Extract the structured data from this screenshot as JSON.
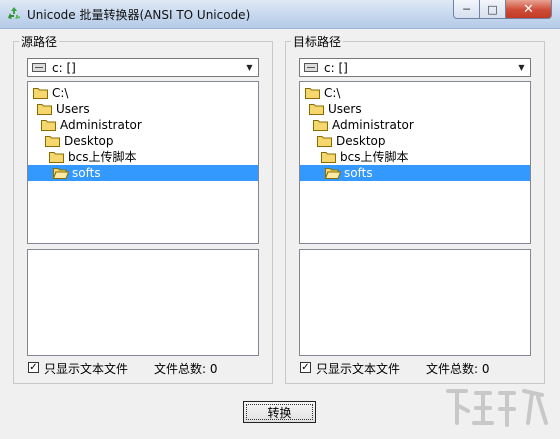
{
  "window": {
    "title": "Unicode 批量转换器(ANSI TO Unicode)",
    "controls": {
      "minimize": "─",
      "maximize": "□",
      "close": "✕"
    }
  },
  "panels": [
    {
      "title": "源路径",
      "drive": "c: []",
      "tree": [
        "C:\\",
        "Users",
        "Administrator",
        "Desktop",
        "bcs上传脚本",
        "softs"
      ],
      "selected": "softs",
      "files": [],
      "checkbox": {
        "checked": true,
        "label": "只显示文本文件"
      },
      "count": "文件总数: 0"
    },
    {
      "title": "目标路径",
      "drive": "c: []",
      "tree": [
        "C:\\",
        "Users",
        "Administrator",
        "Desktop",
        "bcs上传脚本",
        "softs"
      ],
      "selected": "softs",
      "files": [],
      "checkbox": {
        "checked": true,
        "label": "只显示文本文件"
      },
      "count": "文件总数: 0"
    }
  ],
  "convert_button": "转换",
  "icons": {
    "app": "recycle-icon",
    "drive": "drive-icon",
    "folder": "folder-icon",
    "open_folder": "open-folder-icon",
    "dropdown": "chevron-down-icon"
  },
  "colors": {
    "selection": "#3399ff",
    "titlebar": "#c6d7ee",
    "close": "#cf4b36"
  }
}
